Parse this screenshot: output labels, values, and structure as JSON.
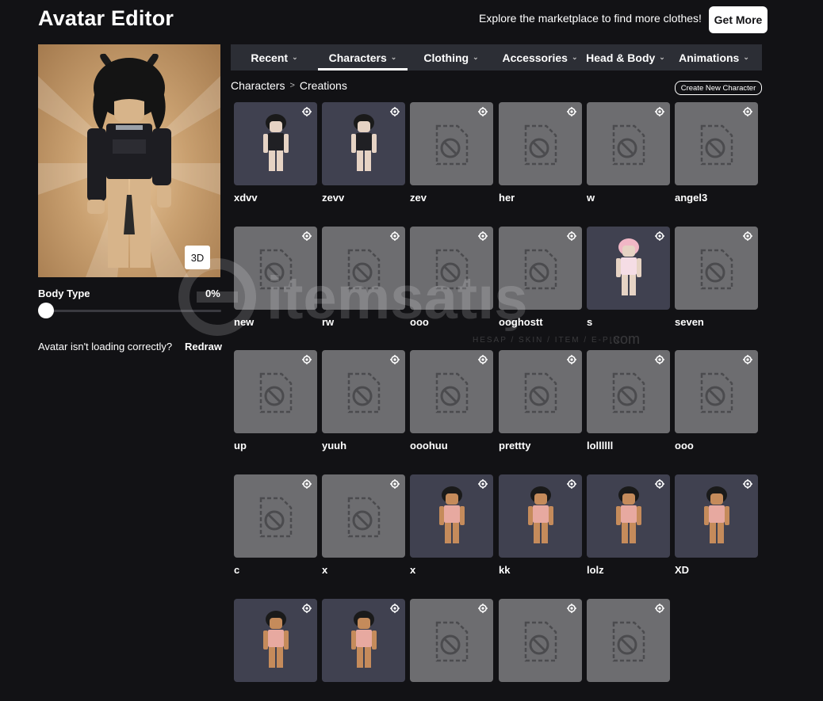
{
  "header": {
    "title": "Avatar Editor",
    "promo_text": "Explore the marketplace to find more clothes!",
    "get_more_label": "Get More"
  },
  "preview": {
    "view_3d_label": "3D",
    "body_type_label": "Body Type",
    "body_type_value": "0%",
    "body_type_fraction": 0.0,
    "redraw_text": "Avatar isn't loading correctly?",
    "redraw_link": "Redraw"
  },
  "tabs": [
    {
      "label": "Recent",
      "active": false
    },
    {
      "label": "Characters",
      "active": true
    },
    {
      "label": "Clothing",
      "active": false
    },
    {
      "label": "Accessories",
      "active": false
    },
    {
      "label": "Head & Body",
      "active": false
    },
    {
      "label": "Animations",
      "active": false
    }
  ],
  "breadcrumb": {
    "root": "Characters",
    "current": "Creations"
  },
  "create_new_label": "Create New Character",
  "characters": [
    {
      "name": "xdvv",
      "thumb": "avatar-dark"
    },
    {
      "name": "zevv",
      "thumb": "avatar-dark"
    },
    {
      "name": "zev",
      "thumb": "placeholder"
    },
    {
      "name": "her",
      "thumb": "placeholder"
    },
    {
      "name": "w",
      "thumb": "placeholder"
    },
    {
      "name": "angel3",
      "thumb": "placeholder"
    },
    {
      "name": "new",
      "thumb": "placeholder"
    },
    {
      "name": "rw",
      "thumb": "placeholder"
    },
    {
      "name": "ooo",
      "thumb": "placeholder"
    },
    {
      "name": "ooghostt",
      "thumb": "placeholder"
    },
    {
      "name": "s",
      "thumb": "avatar-pink"
    },
    {
      "name": "seven",
      "thumb": "placeholder"
    },
    {
      "name": "up",
      "thumb": "placeholder"
    },
    {
      "name": "yuuh",
      "thumb": "placeholder"
    },
    {
      "name": "ooohuu",
      "thumb": "placeholder"
    },
    {
      "name": "prettty",
      "thumb": "placeholder"
    },
    {
      "name": "lollllll",
      "thumb": "placeholder"
    },
    {
      "name": "ooo",
      "thumb": "placeholder"
    },
    {
      "name": "c",
      "thumb": "placeholder"
    },
    {
      "name": "x",
      "thumb": "placeholder"
    },
    {
      "name": "x",
      "thumb": "avatar-tan"
    },
    {
      "name": "kk",
      "thumb": "avatar-tan"
    },
    {
      "name": "lolz",
      "thumb": "avatar-tan"
    },
    {
      "name": "XD",
      "thumb": "avatar-tan"
    },
    {
      "name": "",
      "thumb": "avatar-tan"
    },
    {
      "name": "",
      "thumb": "avatar-tan"
    },
    {
      "name": "",
      "thumb": "placeholder"
    },
    {
      "name": "",
      "thumb": "placeholder"
    },
    {
      "name": "",
      "thumb": "placeholder"
    }
  ],
  "watermark": {
    "brand": "itemsatış",
    "tagline": "HESAP / SKIN / ITEM / E-PIN",
    "domain": ".com"
  },
  "colors": {
    "background": "#121215",
    "tab_bar": "#2c2e35",
    "placeholder_card": "#6d6d70",
    "avatar_card": "#404150"
  }
}
